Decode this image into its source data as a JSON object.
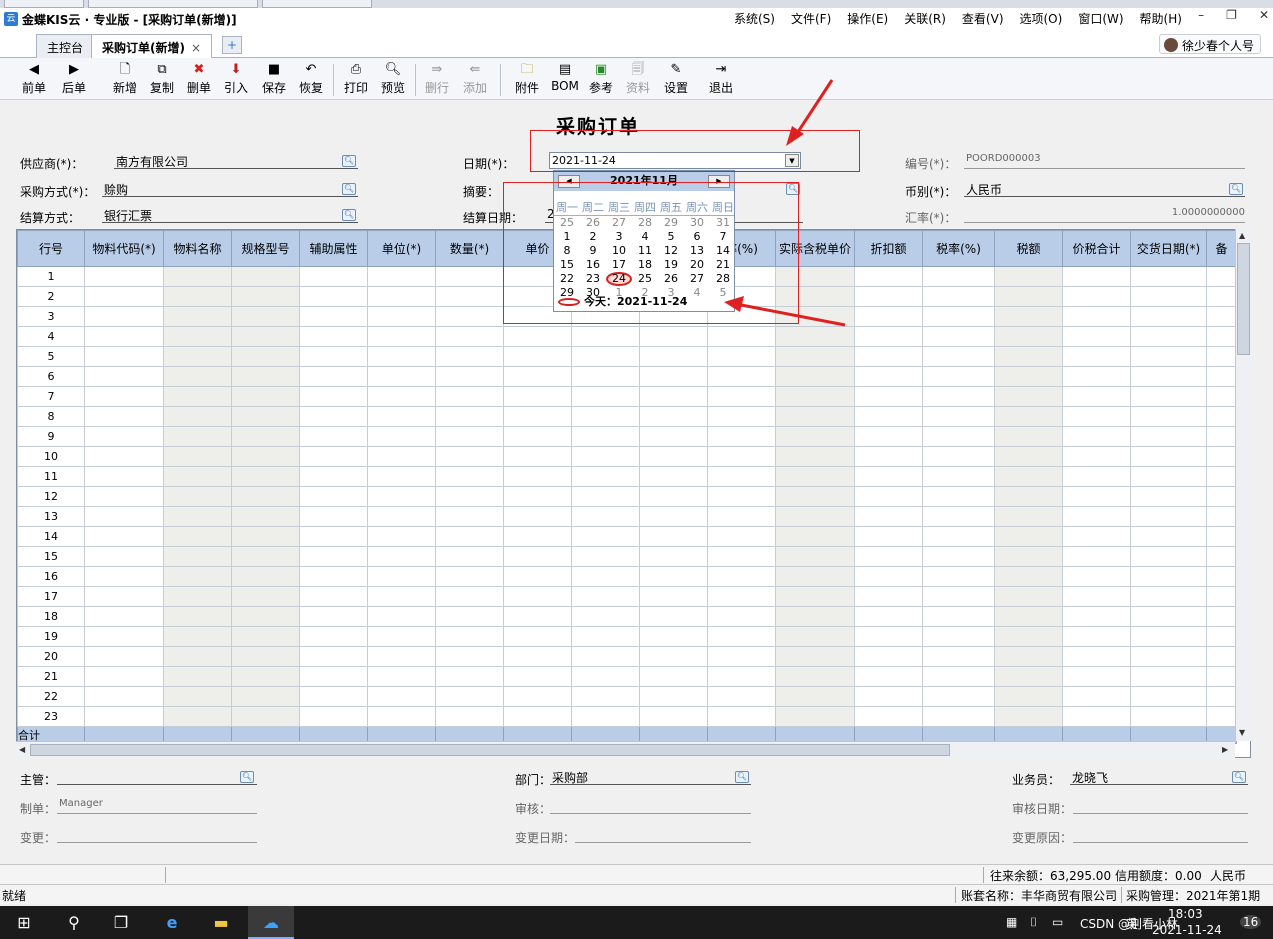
{
  "window": {
    "title": "金蝶KIS云 · 专业版 - [采购订单(新增)]",
    "menus": [
      "系统(S)",
      "文件(F)",
      "操作(E)",
      "关联(R)",
      "查看(V)",
      "选项(O)",
      "窗口(W)",
      "帮助(H)"
    ]
  },
  "tabs": {
    "home": "主控台",
    "active": "采购订单(新增)",
    "close": "×",
    "add": "+"
  },
  "user": {
    "name": "徐少春个人号"
  },
  "toolbar": {
    "prev": "前单",
    "next": "后单",
    "new": "新增",
    "copy": "复制",
    "delete": "删单",
    "import": "引入",
    "save": "保存",
    "restore": "恢复",
    "print": "打印",
    "preview": "预览",
    "delete_row": "删行",
    "add_row": "添加",
    "attach": "附件",
    "bom": "BOM",
    "ref": "参考",
    "data": "资料",
    "settings": "设置",
    "exit": "退出"
  },
  "form": {
    "title": "采购订单",
    "supplier_label": "供应商(*)：",
    "supplier_value": "南方有限公司",
    "date_label": "日期(*)：",
    "date_value": "2021-11-24",
    "number_label": "编号(*)：",
    "number_value": "POORD000003",
    "purchase_method_label": "采购方式(*)：",
    "purchase_method_value": "赊购",
    "summary_label": "摘要：",
    "currency_label": "币别(*)：",
    "currency_value": "人民币",
    "settlement_label": "结算方式：",
    "settlement_value": "银行汇票",
    "settlement_date_label": "结算日期：",
    "settlement_date_value": "2",
    "rate_label": "汇率(*)：",
    "rate_value": "1.0000000000"
  },
  "grid": {
    "headers": [
      "行号",
      "物料代码(*)",
      "物料名称",
      "规格型号",
      "辅助属性",
      "单位(*)",
      "数量(*)",
      "单价",
      "",
      "",
      "率(%)",
      "实际含税单价",
      "折扣额",
      "税率(%)",
      "税额",
      "价税合计",
      "交货日期(*)",
      "备"
    ],
    "rows": [
      "1",
      "2",
      "3",
      "4",
      "5",
      "6",
      "7",
      "8",
      "9",
      "10",
      "11",
      "12",
      "13",
      "14",
      "15",
      "16",
      "17",
      "18",
      "19",
      "20",
      "21",
      "22",
      "23"
    ],
    "total_label": "合计"
  },
  "calendar": {
    "month_label": "2021年11月",
    "weekdays": [
      "周一",
      "周二",
      "周三",
      "周四",
      "周五",
      "周六",
      "周日"
    ],
    "days": [
      "25",
      "26",
      "27",
      "28",
      "29",
      "30",
      "31",
      "1",
      "2",
      "3",
      "4",
      "5",
      "6",
      "7",
      "8",
      "9",
      "10",
      "11",
      "12",
      "13",
      "14",
      "15",
      "16",
      "17",
      "18",
      "19",
      "20",
      "21",
      "22",
      "23",
      "24",
      "25",
      "26",
      "27",
      "28",
      "29",
      "30",
      "1",
      "2",
      "3",
      "4",
      "5"
    ],
    "today_label": "今天：2021-11-24"
  },
  "footer": {
    "supervisor_label": "主管：",
    "dept_label": "部门：",
    "dept_value": "采购部",
    "salesman_label": "业务员：",
    "salesman_value": "龙晓飞",
    "maker_label": "制单：",
    "maker_value": "Manager",
    "auditor_label": "审核：",
    "audit_date_label": "审核日期：",
    "change_label": "变更：",
    "change_date_label": "变更日期：",
    "change_reason_label": "变更原因："
  },
  "status": {
    "balance": "往来余额：63,295.00",
    "credit": "信用额度：0.00",
    "currency": "人民币",
    "ready": "就绪",
    "account": "账套名称：丰华商贸有限公司",
    "module": "采购管理：2021年第1期"
  },
  "taskbar": {
    "clock_time": "18:03",
    "clock_date": "2021-11-24",
    "watermark": "CSDN @别看小林",
    "lang": "英",
    "notif_count": "16"
  }
}
